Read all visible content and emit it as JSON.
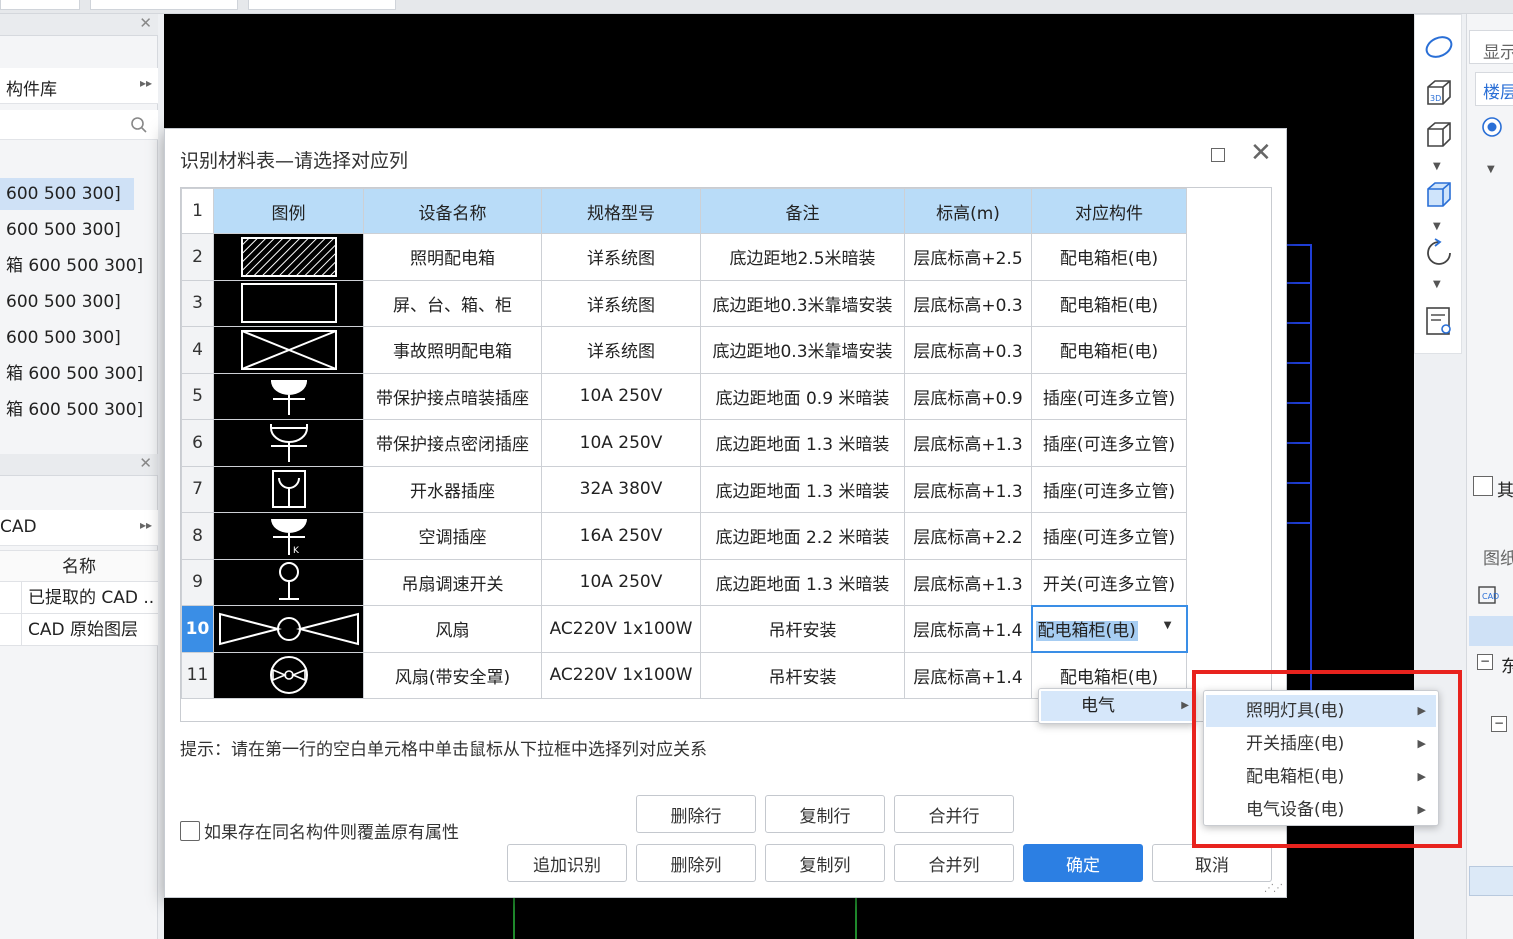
{
  "left_panel": {
    "library_label": "构件库",
    "list_items": [
      "600 500 300]",
      "600 500 300]",
      "箱 600 500 300]",
      "600 500 300]",
      "600 500 300]",
      "箱 600 500 300]",
      "箱 600 500 300]"
    ],
    "cad_label": "CAD",
    "table_header": "名称",
    "rows": [
      "已提取的 CAD ..",
      "CAD 原始图层"
    ]
  },
  "right_panel": {
    "display_label": "显示",
    "floor_tab": "楼层",
    "other_label": "其",
    "legend_label": "图纸",
    "east_label": "东"
  },
  "dialog": {
    "title": "识别材料表—请选择对应列",
    "headers": [
      "1",
      "图例",
      "设备名称",
      "规格型号",
      "备注",
      "标高(m)",
      "对应构件"
    ],
    "rows": [
      {
        "num": "2",
        "symbol": "hatched-box",
        "name": "照明配电箱",
        "spec": "详系统图",
        "note": "底边距地2.5米暗装",
        "elev": "层底标高+2.5",
        "comp": "配电箱柜(电)"
      },
      {
        "num": "3",
        "symbol": "empty-box",
        "name": "屏、台、箱、柜",
        "spec": "详系统图",
        "note": "底边距地0.3米靠墙安装",
        "elev": "层底标高+0.3",
        "comp": "配电箱柜(电)"
      },
      {
        "num": "4",
        "symbol": "cross-box",
        "name": "事故照明配电箱",
        "spec": "详系统图",
        "note": "底边距地0.3米靠墙安装",
        "elev": "层底标高+0.3",
        "comp": "配电箱柜(电)"
      },
      {
        "num": "5",
        "symbol": "filled-socket",
        "name": "带保护接点暗装插座",
        "spec": "10A 250V",
        "note": "底边距地面 0.9 米暗装",
        "elev": "层底标高+0.9",
        "comp": "插座(可连多立管)"
      },
      {
        "num": "6",
        "symbol": "sealed-socket",
        "name": "带保护接点密闭插座",
        "spec": "10A 250V",
        "note": "底边距地面 1.3 米暗装",
        "elev": "层底标高+1.3",
        "comp": "插座(可连多立管)"
      },
      {
        "num": "7",
        "symbol": "boiler-socket",
        "name": "开水器插座",
        "spec": "32A 380V",
        "note": "底边距地面 1.3 米暗装",
        "elev": "层底标高+1.3",
        "comp": "插座(可连多立管)"
      },
      {
        "num": "8",
        "symbol": "ac-socket",
        "name": "空调插座",
        "spec": "16A 250V",
        "note": "底边距地面 2.2 米暗装",
        "elev": "层底标高+2.2",
        "comp": "插座(可连多立管)"
      },
      {
        "num": "9",
        "symbol": "fan-switch",
        "name": "吊扇调速开关",
        "spec": "10A 250V",
        "note": "底边距地面 1.3 米暗装",
        "elev": "层底标高+1.3",
        "comp": "开关(可连多立管)"
      },
      {
        "num": "10",
        "symbol": "fan",
        "name": "风扇",
        "spec": "AC220V 1x100W",
        "note": "吊杆安装",
        "elev": "层底标高+1.4",
        "comp": "配电箱柜(电)"
      },
      {
        "num": "11",
        "symbol": "fan-guard",
        "name": "风扇(带安全罩)",
        "spec": "AC220V 1x100W",
        "note": "吊杆安装",
        "elev": "层底标高+1.4",
        "comp": "配电箱柜(电)"
      }
    ],
    "hint": "提示：请在第一行的空白单元格中单击鼠标从下拉框中选择列对应关系",
    "overwrite_checkbox": "如果存在同名构件则覆盖原有属性",
    "buttons": {
      "delete_row": "删除行",
      "copy_row": "复制行",
      "merge_row": "合并行",
      "append": "追加识别",
      "delete_col": "删除列",
      "copy_col": "复制列",
      "merge_col": "合并列",
      "ok": "确定",
      "cancel": "取消"
    }
  },
  "menu": {
    "category": "电气",
    "items": [
      "照明灯具(电)",
      "开关插座(电)",
      "配电箱柜(电)",
      "电气设备(电)"
    ]
  },
  "colors": {
    "header_bg": "#b9dcf8",
    "selection": "#3a8ee6",
    "primary_button": "#2c7fe3",
    "highlight_box": "#e8231e"
  }
}
